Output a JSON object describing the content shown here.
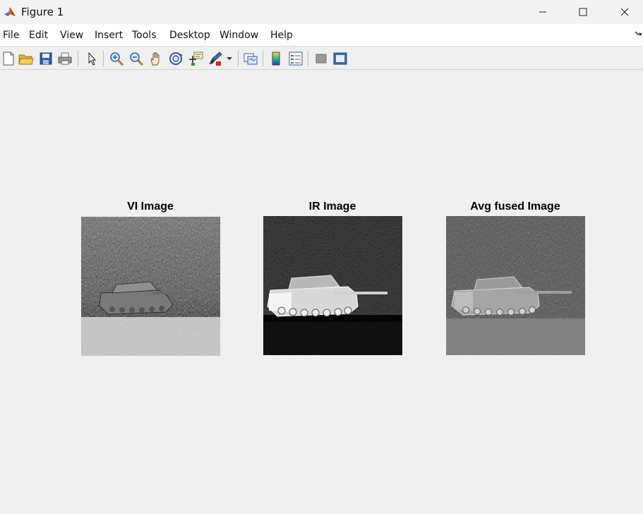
{
  "window": {
    "title": "Figure 1",
    "app_icon": "matlab-logo-icon",
    "controls": [
      "minimize-icon",
      "maximize-icon",
      "close-icon"
    ]
  },
  "menubar": {
    "items": [
      "File",
      "Edit",
      "View",
      "Insert",
      "Tools",
      "Desktop",
      "Window",
      "Help"
    ]
  },
  "toolbar": {
    "buttons": [
      "new-figure-icon",
      "open-file-icon",
      "save-icon",
      "print-icon",
      "edit-plot-arrow-icon",
      "zoom-in-icon",
      "zoom-out-icon",
      "pan-hand-icon",
      "rotate-3d-icon",
      "data-cursor-icon",
      "brush-icon",
      "brush-dropdown-icon",
      "link-plot-icon",
      "insert-colorbar-icon",
      "insert-legend-icon",
      "hide-plot-tools-icon",
      "show-plot-tools-icon"
    ]
  },
  "figure": {
    "panels": [
      {
        "title": "VI Image"
      },
      {
        "title": "IR Image"
      },
      {
        "title": "Avg fused Image"
      }
    ]
  },
  "colors": {
    "titlebar_bg": "#f3f3f3",
    "menubar_bg": "#ffffff",
    "figure_bg": "#f0f0f0",
    "matlab_orange": "#e86b1f"
  }
}
